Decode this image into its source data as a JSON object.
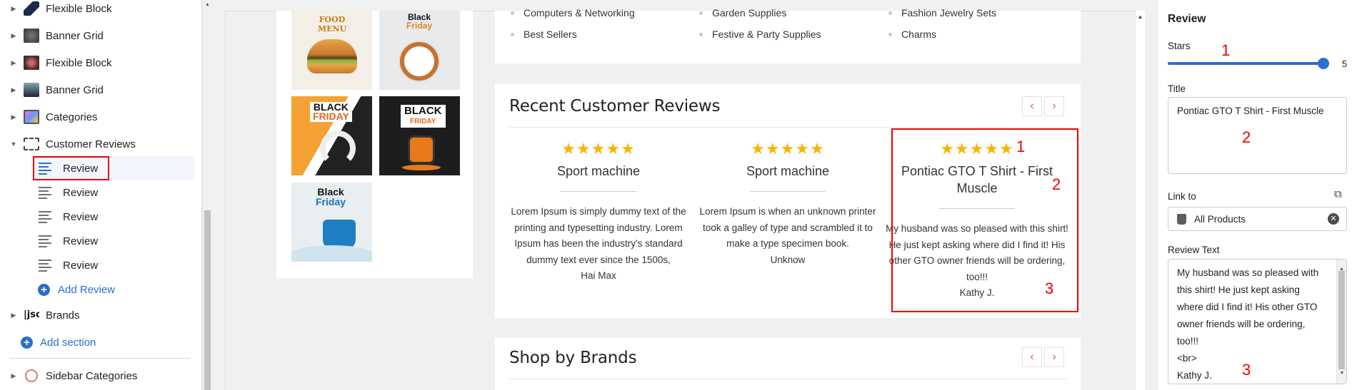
{
  "sidebar": {
    "tree": [
      {
        "label": "Flexible Block",
        "icon": "image-thumbnail-icon"
      },
      {
        "label": "Banner Grid",
        "icon": "image-thumbnail-icon"
      },
      {
        "label": "Flexible Block",
        "icon": "image-thumbnail-icon"
      },
      {
        "label": "Banner Grid",
        "icon": "image-thumbnail-icon"
      },
      {
        "label": "Categories",
        "icon": "categories-icon"
      },
      {
        "label": "Customer Reviews",
        "icon": "carousel-icon"
      }
    ],
    "reviews": [
      "Review",
      "Review",
      "Review",
      "Review",
      "Review"
    ],
    "add_review": "Add Review",
    "brands": "Brands",
    "add_section": "Add section",
    "sidebar_categories": "Sidebar Categories"
  },
  "preview": {
    "categories": {
      "col1": [
        "Computers & Networking",
        "Best Sellers"
      ],
      "col2": [
        "Garden Supplies",
        "Festive & Party Supplies"
      ],
      "col3": [
        "Fashion Jewelry Sets",
        "Charms"
      ]
    },
    "reviews_section": {
      "title": "Recent Customer Reviews",
      "prev": "‹",
      "next": "›",
      "items": [
        {
          "stars": "★★★★★",
          "title": "Sport machine",
          "text": "Lorem Ipsum is simply dummy text of the printing and typesetting industry. Lorem Ipsum has been the industry's standard dummy text ever since the 1500s,",
          "author": "Hai Max"
        },
        {
          "stars": "★★★★★",
          "title": "Sport machine",
          "text": "Lorem Ipsum is when an unknown printer took a galley of type and scrambled it to make a type specimen book.",
          "author": "Unknow"
        },
        {
          "stars": "★★★★★",
          "title": "Pontiac GTO T Shirt - First Muscle",
          "text": "My husband was so pleased with this shirt! He just kept asking where did I find it! His other GTO owner friends will be ordering, too!!!",
          "author": "Kathy J."
        }
      ]
    },
    "brands_section": {
      "title": "Shop by Brands",
      "prev": "‹",
      "next": "›"
    },
    "promos": [
      {
        "line1": "FOOD MENU",
        "line2": ""
      },
      {
        "line1": "Black",
        "line2": "Friday"
      },
      {
        "line1": "BLACK",
        "line2": "FRIDAY"
      },
      {
        "line1": "BLACK",
        "line2": "FRIDAY"
      },
      {
        "line1": "Black",
        "line2": "Friday"
      }
    ]
  },
  "annotations": {
    "one": "1",
    "two": "2",
    "three": "3"
  },
  "panel": {
    "heading": "Review",
    "stars_label": "Stars",
    "stars_value": "5",
    "stars_fraction": 1.0,
    "title_label": "Title",
    "title_value": "Pontiac GTO T Shirt - First Muscle",
    "link_label": "Link to",
    "link_value": "All Products",
    "text_label": "Review Text",
    "text_lines": [
      "My husband was so pleased with",
      "this shirt! He just kept asking",
      "where did I find it! His other GTO",
      "owner friends will be ordering,",
      "too!!!",
      "<br>",
      "Kathy J."
    ]
  },
  "colors": {
    "accent": "#2c6ecb",
    "star": "#f7b500",
    "annotation": "#e00000",
    "nav_arrow": "#e25555"
  }
}
